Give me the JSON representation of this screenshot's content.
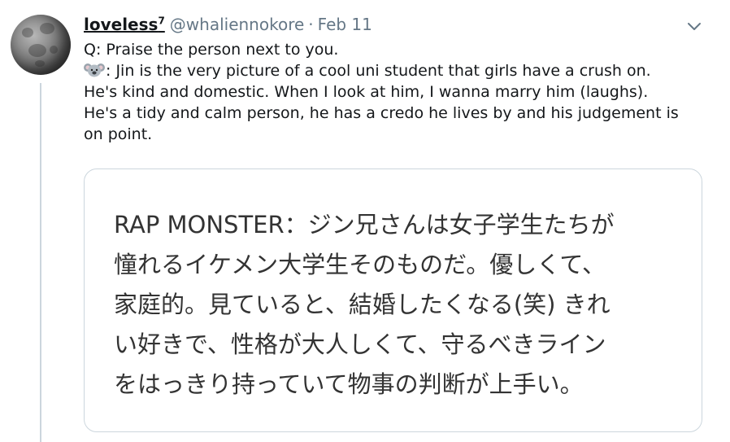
{
  "tweet": {
    "author": {
      "display_name": "loveless",
      "superscript": "7",
      "handle": "@whaliennokore",
      "separator": "·",
      "date": "Feb 11",
      "avatar_icon": "moon-avatar-icon"
    },
    "menu_icon": "chevron-down-icon",
    "text_lines": [
      "Q: Praise the person next to you.",
      ": Jin is the very picture of a cool uni student that girls have a crush on.",
      "He's kind and domestic. When I look at him, I wanna marry him (laughs).",
      "He's a tidy and calm person, he has a credo he lives by and his judgement is",
      "on point."
    ],
    "emoji_icon": "koala-icon",
    "media": {
      "lines": [
        "RAP MONSTER：ジン兄さんは女子学生たちが",
        "憧れるイケメン大学生そのものだ。優しくて、",
        "家庭的。見ていると、結婚したくなる(笑) きれ",
        "い好きで、性格が大人しくて、守るべきライン",
        "をはっきり持っていて物事の判断が上手い。"
      ]
    }
  },
  "colors": {
    "text": "#14171a",
    "muted": "#657786",
    "border": "#ccd6dd",
    "media_text": "#333333"
  }
}
